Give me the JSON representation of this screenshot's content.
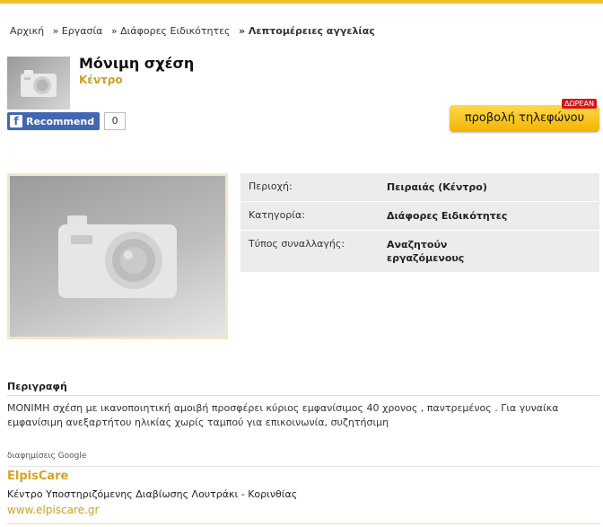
{
  "breadcrumb": {
    "items": [
      "Αρχική",
      "» Εργασία",
      "» Διάφορες Ειδικότητες",
      "» Λεπτομέρειες αγγελίας"
    ]
  },
  "listing": {
    "title": "Μόνιμη σχέση",
    "location": "Κέντρο"
  },
  "facebook": {
    "recommend_label": "Recommend",
    "count": "0"
  },
  "phone": {
    "button_label": "προβολή τηλεφώνου",
    "badge": "ΔΩΡΕΑΝ"
  },
  "details": [
    {
      "label": "Περιοχή:",
      "value": "Πειραιάς (Κέντρο)"
    },
    {
      "label": "Κατηγορία:",
      "value": "Διάφορες Ειδικότητες"
    },
    {
      "label": "Τύπος συναλλαγής:",
      "value": "Αναζητούν εργαζόμενους"
    }
  ],
  "description": {
    "heading": "Περιγραφή",
    "text": "ΜΟΝΙΜΗ σχέση με ικανοποιητική αμοιβή προσφέρει κύριος εμφανίσιμος 40 χρονος , παντρεμένος . Για γυναίκα εμφανίσιμη ανεξαρτήτου ηλικίας χωρίς ταμπού για επικοινωνία, συζητήσιμη"
  },
  "ads": {
    "label": "διαφημίσεις Google",
    "title": "ElpisCare",
    "text": "Κέντρο Υποστηριζόμενης Διαβίωσης  Λουτράκι - Κορινθίας",
    "url": "www.elpiscare.gr"
  },
  "colors": {
    "accent": "#f2c12e",
    "link_gold": "#c9a227",
    "badge_red": "#d4161b",
    "facebook_blue": "#4267b2"
  }
}
